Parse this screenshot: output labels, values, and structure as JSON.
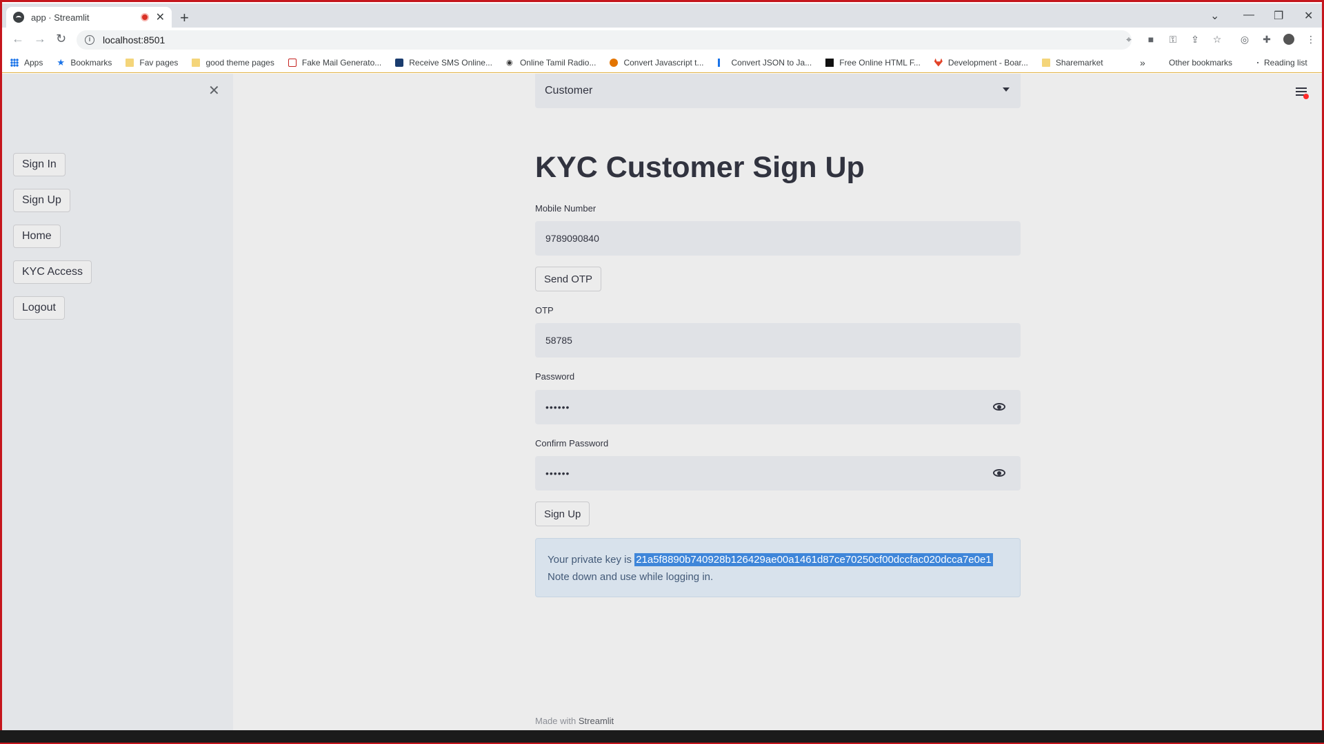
{
  "browser": {
    "tab_title": "app · Streamlit",
    "url": "localhost:8501",
    "bookmarks": [
      {
        "label": "Apps",
        "icon": "apps-grid-icon"
      },
      {
        "label": "Bookmarks",
        "icon": "star-icon"
      },
      {
        "label": "Fav pages",
        "icon": "folder-icon"
      },
      {
        "label": "good theme pages",
        "icon": "folder-icon"
      },
      {
        "label": "Fake Mail Generato...",
        "icon": "mail-icon"
      },
      {
        "label": "Receive SMS Online...",
        "icon": "sms-icon"
      },
      {
        "label": "Online Tamil Radio...",
        "icon": "radio-icon"
      },
      {
        "label": "Convert Javascript t...",
        "icon": "convert-icon"
      },
      {
        "label": "Convert JSON to Ja...",
        "icon": "json-icon"
      },
      {
        "label": "Free Online HTML F...",
        "icon": "html-icon"
      },
      {
        "label": "Development - Boar...",
        "icon": "gitlab-icon"
      },
      {
        "label": "Sharemarket",
        "icon": "folder-icon"
      }
    ],
    "overflow": "»",
    "other_bookmarks": "Other bookmarks",
    "reading_list": "Reading list"
  },
  "sidebar": {
    "buttons": [
      "Sign In",
      "Sign Up",
      "Home",
      "KYC Access",
      "Logout"
    ]
  },
  "main": {
    "role_select": "Customer",
    "title": "KYC Customer Sign Up",
    "mobile_label": "Mobile Number",
    "mobile_value": "9789090840",
    "send_otp": "Send OTP",
    "otp_label": "OTP",
    "otp_value": "58785",
    "password_label": "Password",
    "password_value": "••••••",
    "confirm_label": "Confirm Password",
    "confirm_value": "••••••",
    "signup_button": "Sign Up",
    "alert_prefix": "Your private key is ",
    "private_key": "21a5f8890b740928b126429ae00a1461d87ce70250cf00dccfac020dcca7e0e1",
    "alert_note": "Note down and use while logging in."
  },
  "footer": {
    "prefix": "Made with ",
    "brand": "Streamlit"
  },
  "colors": {
    "accent_alert_bg": "#d8e2ec",
    "selection": "#3f86d9",
    "notification_dot": "#ff2b2b"
  }
}
